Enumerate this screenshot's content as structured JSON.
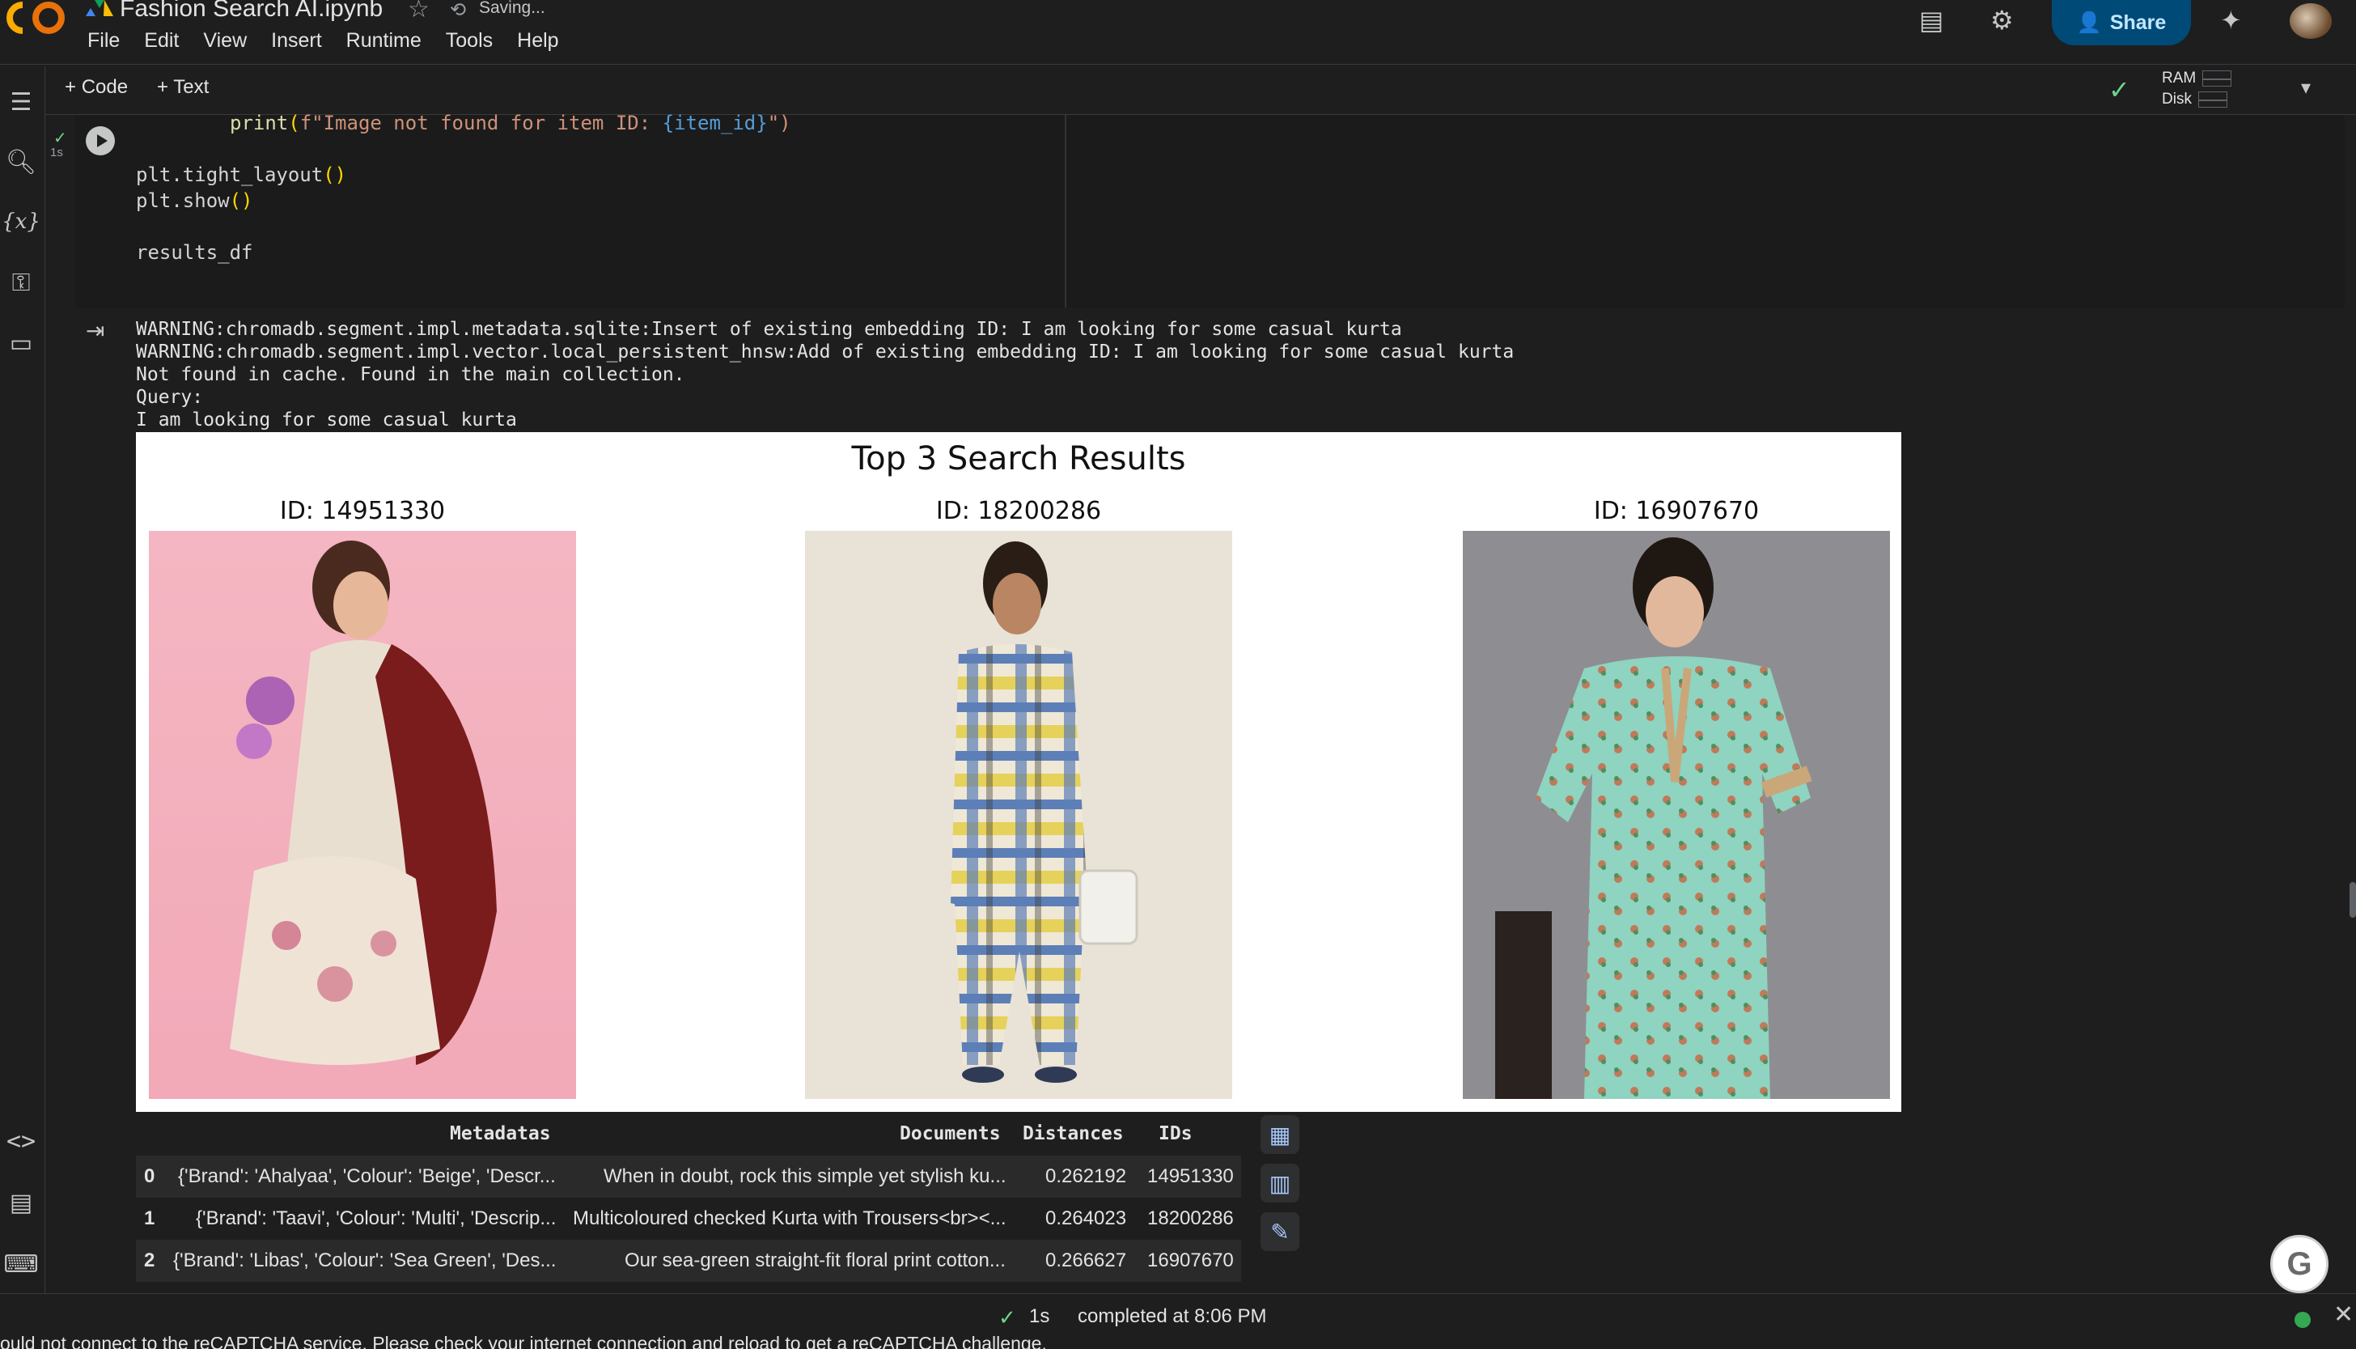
{
  "header": {
    "title": "Fashion Search AI.ipynb",
    "saving": "Saving...",
    "menu": [
      "File",
      "Edit",
      "View",
      "Insert",
      "Runtime",
      "Tools",
      "Help"
    ],
    "share_label": "Share"
  },
  "toolbar": {
    "code_label": "Code",
    "text_label": "Text",
    "ram_label": "RAM",
    "disk_label": "Disk"
  },
  "cell": {
    "exec_time": "1s",
    "code_lines": {
      "line1_fn": "print",
      "line1_str": "f\"Image not found for item ID: ",
      "line1_var": "{item_id}",
      "line1_end": "\")",
      "line2": "plt.tight_layout",
      "line3": "plt.show",
      "line4": "results_df"
    }
  },
  "output": {
    "lines": [
      "WARNING:chromadb.segment.impl.metadata.sqlite:Insert of existing embedding ID: I am looking for some casual kurta",
      "WARNING:chromadb.segment.impl.vector.local_persistent_hnsw:Add of existing embedding ID: I am looking for some casual kurta",
      "Not found in cache. Found in the main collection.",
      "Query:",
      "I am looking for some casual kurta"
    ],
    "figure": {
      "title": "Top 3 Search Results",
      "items": [
        {
          "label": "ID: 14951330"
        },
        {
          "label": "ID: 18200286"
        },
        {
          "label": "ID: 16907670"
        }
      ]
    },
    "table": {
      "headers": [
        "Metadatas",
        "Documents",
        "Distances",
        "IDs"
      ],
      "rows": [
        {
          "index": "0",
          "metadatas": "{'Brand': 'Ahalyaa', 'Colour': 'Beige', 'Descr...",
          "documents": "When in doubt, rock this simple yet stylish ku...",
          "distances": "0.262192",
          "ids": "14951330"
        },
        {
          "index": "1",
          "metadatas": "{'Brand': 'Taavi', 'Colour': 'Multi', 'Descrip...",
          "documents": "Multicoloured checked Kurta with Trousers<br><...",
          "distances": "0.264023",
          "ids": "18200286"
        },
        {
          "index": "2",
          "metadatas": "{'Brand': 'Libas', 'Colour': 'Sea Green', 'Des...",
          "documents": "Our sea-green straight-fit floral print cotton...",
          "distances": "0.266627",
          "ids": "16907670"
        }
      ]
    }
  },
  "status": {
    "time": "1s",
    "text": "completed at 8:06 PM",
    "recaptcha": "ould not connect to the reCAPTCHA service. Please check your internet connection and reload to get a reCAPTCHA challenge."
  },
  "colors": {
    "background": "#1e1e1e",
    "share_bg": "#004a77",
    "success": "#6dd58c",
    "figure_bg": "#ffffff"
  }
}
